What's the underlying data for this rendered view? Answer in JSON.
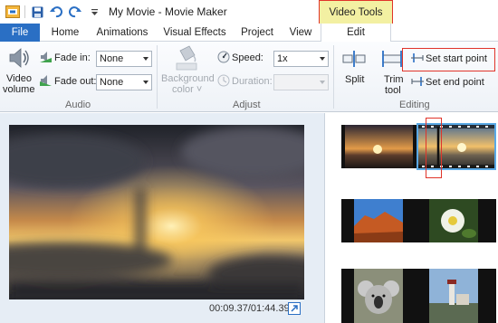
{
  "window": {
    "title": "My Movie - Movie Maker"
  },
  "contextual": {
    "group": "Video Tools"
  },
  "tabs": [
    "File",
    "Home",
    "Animations",
    "Visual Effects",
    "Project",
    "View",
    "Edit"
  ],
  "audio": {
    "video_volume": [
      "Video",
      "volume"
    ],
    "fade_in_label": "Fade in:",
    "fade_in_value": "None",
    "fade_out_label": "Fade out:",
    "fade_out_value": "None",
    "group_label": "Audio"
  },
  "adjust": {
    "background_color": [
      "Background",
      "color ˅"
    ],
    "speed_label": "Speed:",
    "speed_value": "1x",
    "duration_label": "Duration:",
    "duration_value": "",
    "group_label": "Adjust"
  },
  "editing": {
    "split": "Split",
    "trim_tool": [
      "Trim",
      "tool"
    ],
    "set_start": "Set start point",
    "set_end": "Set end point",
    "group_label": "Editing"
  },
  "preview": {
    "timecode": "00:09.37/01:44.39"
  },
  "colors": {
    "accent": "#2a6fc4",
    "highlight": "#e0342a",
    "contextual": "#f3f0a2"
  }
}
